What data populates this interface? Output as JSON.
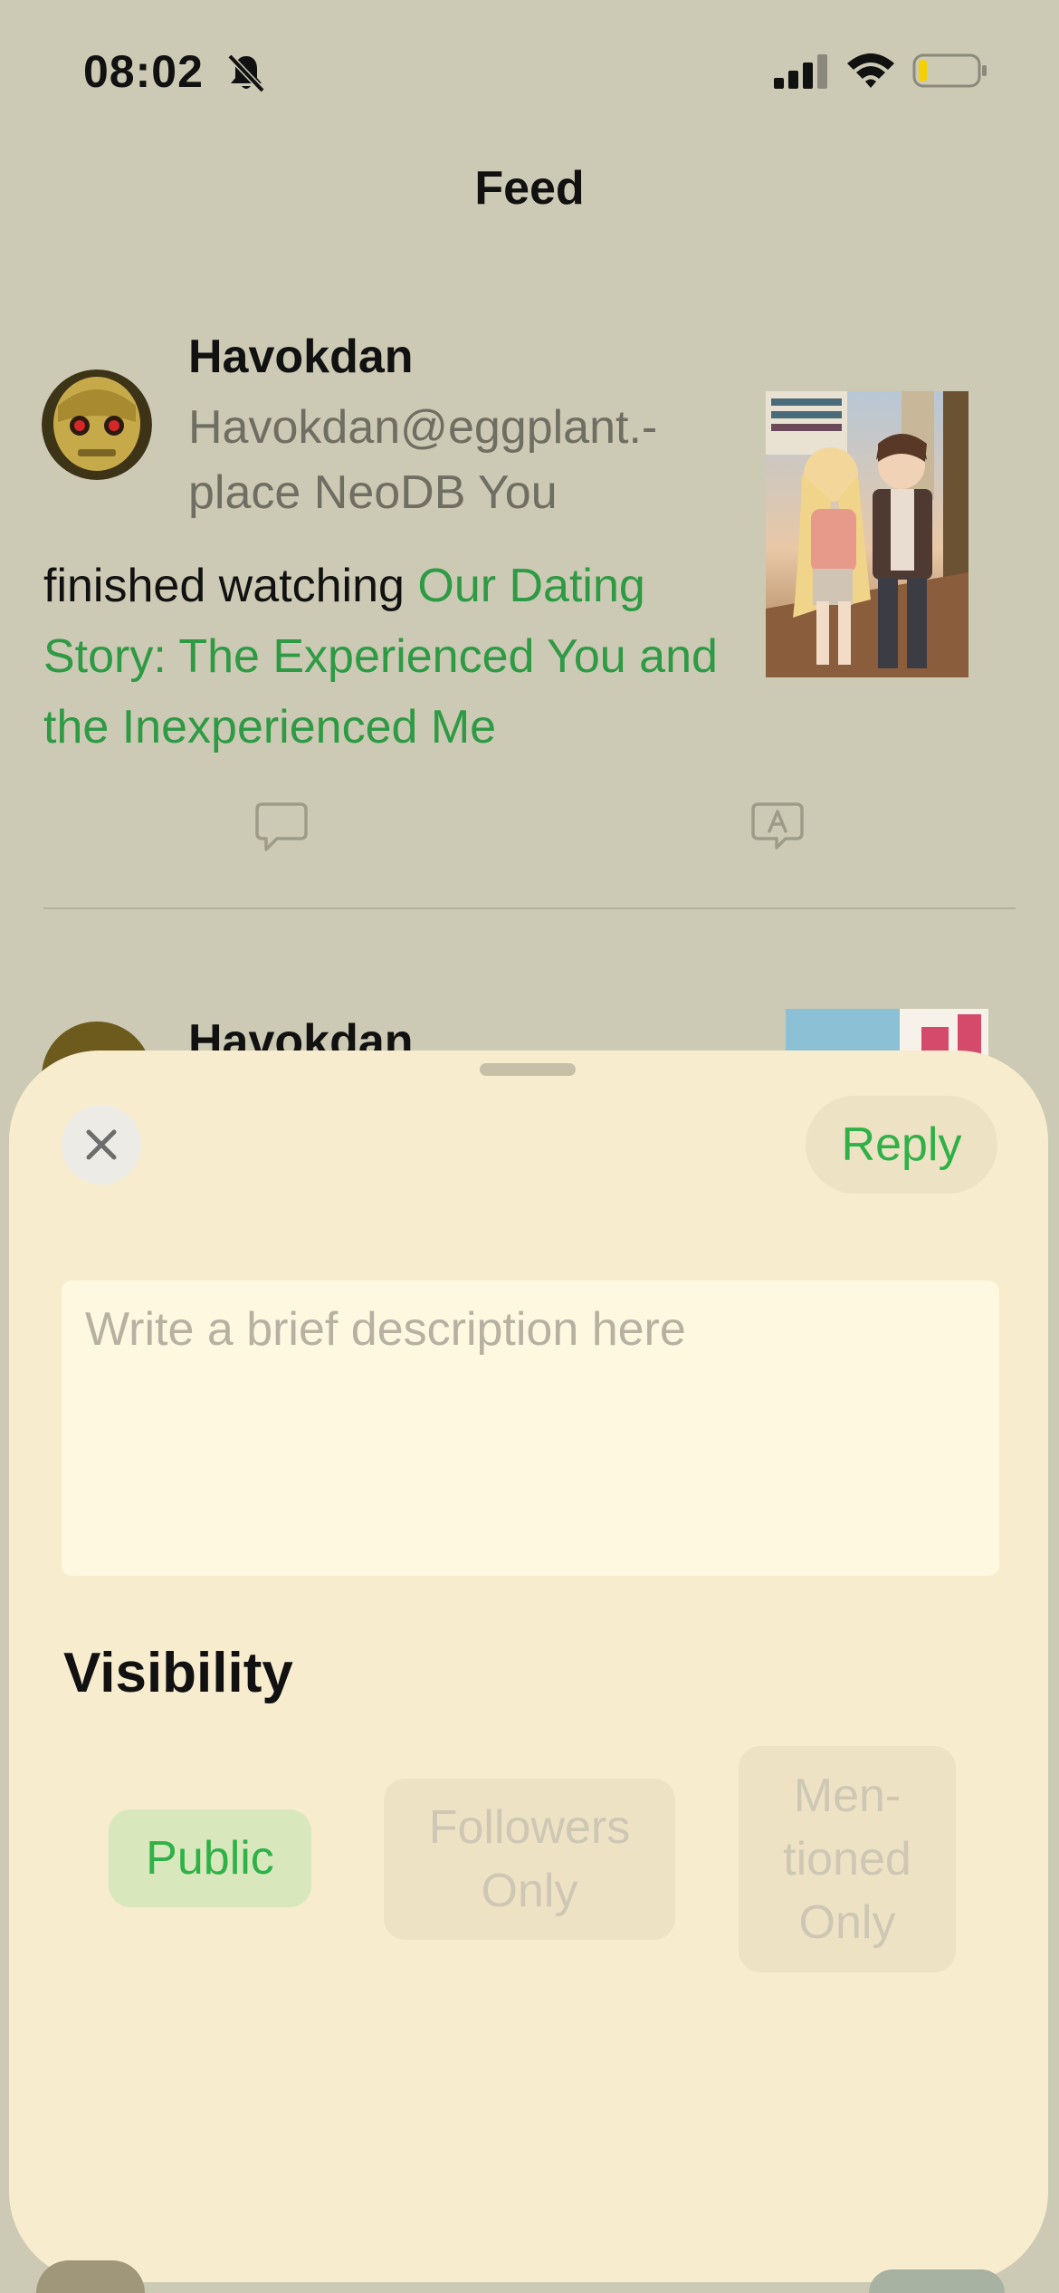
{
  "status_bar": {
    "time": "08:02",
    "icons": [
      "bell-slash-icon",
      "cellular-signal-icon",
      "wifi-icon",
      "battery-icon"
    ],
    "battery_level": 0.15
  },
  "nav": {
    "title": "Feed"
  },
  "posts": [
    {
      "author": "Havokdan",
      "handle": "Havokdan@eggplant.-place NeoDB You",
      "action": "finished watching",
      "title": "Our Dating Story: The Experienced You and the Inexperienced Me",
      "icons": [
        "comment-icon",
        "translate-icon"
      ]
    },
    {
      "author": "Havokdan"
    }
  ],
  "sheet": {
    "reply_label": "Reply",
    "close_icon": "close-icon",
    "placeholder": "Write a brief description here",
    "visibility_title": "Visibility",
    "options": [
      {
        "label": "Public",
        "selected": true
      },
      {
        "label": "Followers Only",
        "selected": false
      },
      {
        "label": "Men-tioned Only",
        "selected": false
      }
    ]
  },
  "colors": {
    "accent_green": "#2fb148",
    "link_green": "#2e9a44",
    "sheet_bg": "#f8ecce",
    "backdrop": "#cccab4",
    "battery_low": "#f5d000"
  }
}
